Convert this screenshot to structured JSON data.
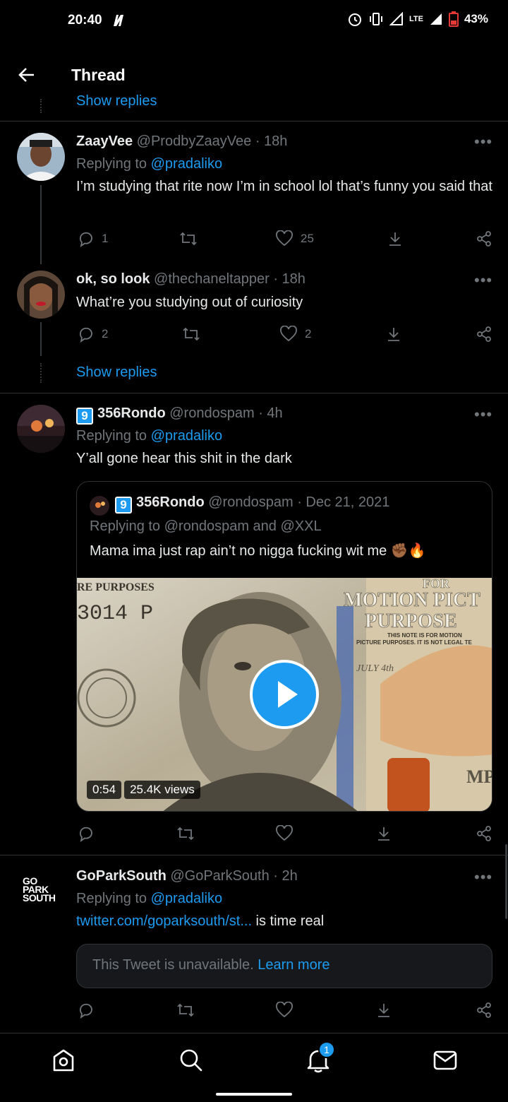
{
  "status_bar": {
    "time": "20:40",
    "network": "LTE",
    "battery": "43%"
  },
  "header": {
    "title": "Thread",
    "peek_text": "Show replies"
  },
  "tweets": [
    {
      "name": "ZaayVee",
      "handle": "@ProdbyZaayVee",
      "time": "· 18h",
      "replying_prefix": "Replying to",
      "replying_to": "@pradaliko",
      "text": "I’m studying that rite now I’m in school lol that’s funny you said that",
      "replies": "1",
      "likes": "25"
    },
    {
      "name": "ok, so look",
      "handle": "@thechaneltapper",
      "time": "· 18h",
      "text": "What’re you studying out of curiosity",
      "replies": "2",
      "likes": "2"
    },
    {
      "name": "356Rondo",
      "badge": "9",
      "handle": "@rondospam",
      "time": "· 4h",
      "replying_prefix": "Replying to",
      "replying_to": "@pradaliko",
      "text": "Y’all gone hear this shit in the dark",
      "quote": {
        "name": "356Rondo",
        "badge": "9",
        "handle": "@rondospam",
        "time": "· Dec 21, 2021",
        "replying": "Replying to @rondospam and @XXL",
        "text": "Mama ima just rap ain’t no nigga fucking wit me ✊🏾🔥",
        "duration": "0:54",
        "views": "25.4K views",
        "media_text": [
          "RE PURPOSES",
          "3014 P",
          "FOR",
          "MOTION PICT",
          "PURPOSE",
          "THIS NOTE IS FOR MOTION",
          "PICTURE PURPOSES. IT IS NOT LEGAL TE",
          "JULY 4th",
          "MP"
        ]
      }
    },
    {
      "name": "GoParkSouth",
      "handle": "@GoParkSouth",
      "time": "· 2h",
      "replying_prefix": "Replying to",
      "replying_to": "@pradaliko",
      "link": "twitter.com/goparksouth/st...",
      "text_after": " is time real",
      "logo": [
        "GO",
        "PARK",
        "SOUTH"
      ],
      "unavailable": "This Tweet is unavailable.",
      "learn_more": "Learn more"
    }
  ],
  "show_replies": "Show replies",
  "nav": {
    "notifications_count": "1"
  },
  "colors": {
    "accent": "#1d9bf0",
    "muted": "#71767b",
    "background": "#000000"
  }
}
